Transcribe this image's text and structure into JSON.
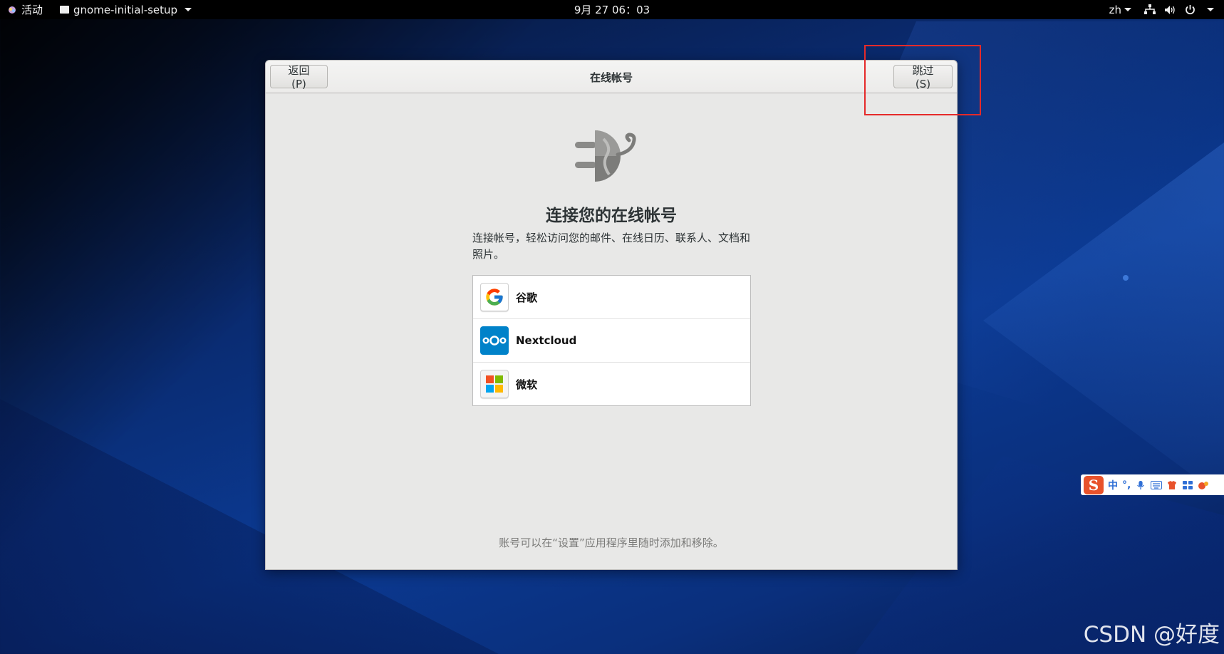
{
  "topbar": {
    "activities": "活动",
    "app_name": "gnome-initial-setup",
    "clock": "9月 27  06：03",
    "language": "zh"
  },
  "dialog": {
    "back_label": "返回(P)",
    "title": "在线帐号",
    "skip_label": "跳过(S)",
    "heading": "连接您的在线帐号",
    "description": "连接帐号，轻松访问您的邮件、在线日历、联系人、文档和照片。",
    "providers": [
      {
        "label": "谷歌",
        "icon": "google-icon"
      },
      {
        "label": "Nextcloud",
        "icon": "nextcloud-icon"
      },
      {
        "label": "微软",
        "icon": "microsoft-icon"
      }
    ],
    "footer_note": "账号可以在“设置”应用程序里随时添加和移除。"
  },
  "ime_toolbar": {
    "logo": "S",
    "mode": "中",
    "punct": "°,"
  },
  "watermark": "CSDN @好度",
  "colors": {
    "highlight": "#e52a2a",
    "nextcloud_blue": "#0082c9",
    "ime_orange": "#e8522b"
  }
}
